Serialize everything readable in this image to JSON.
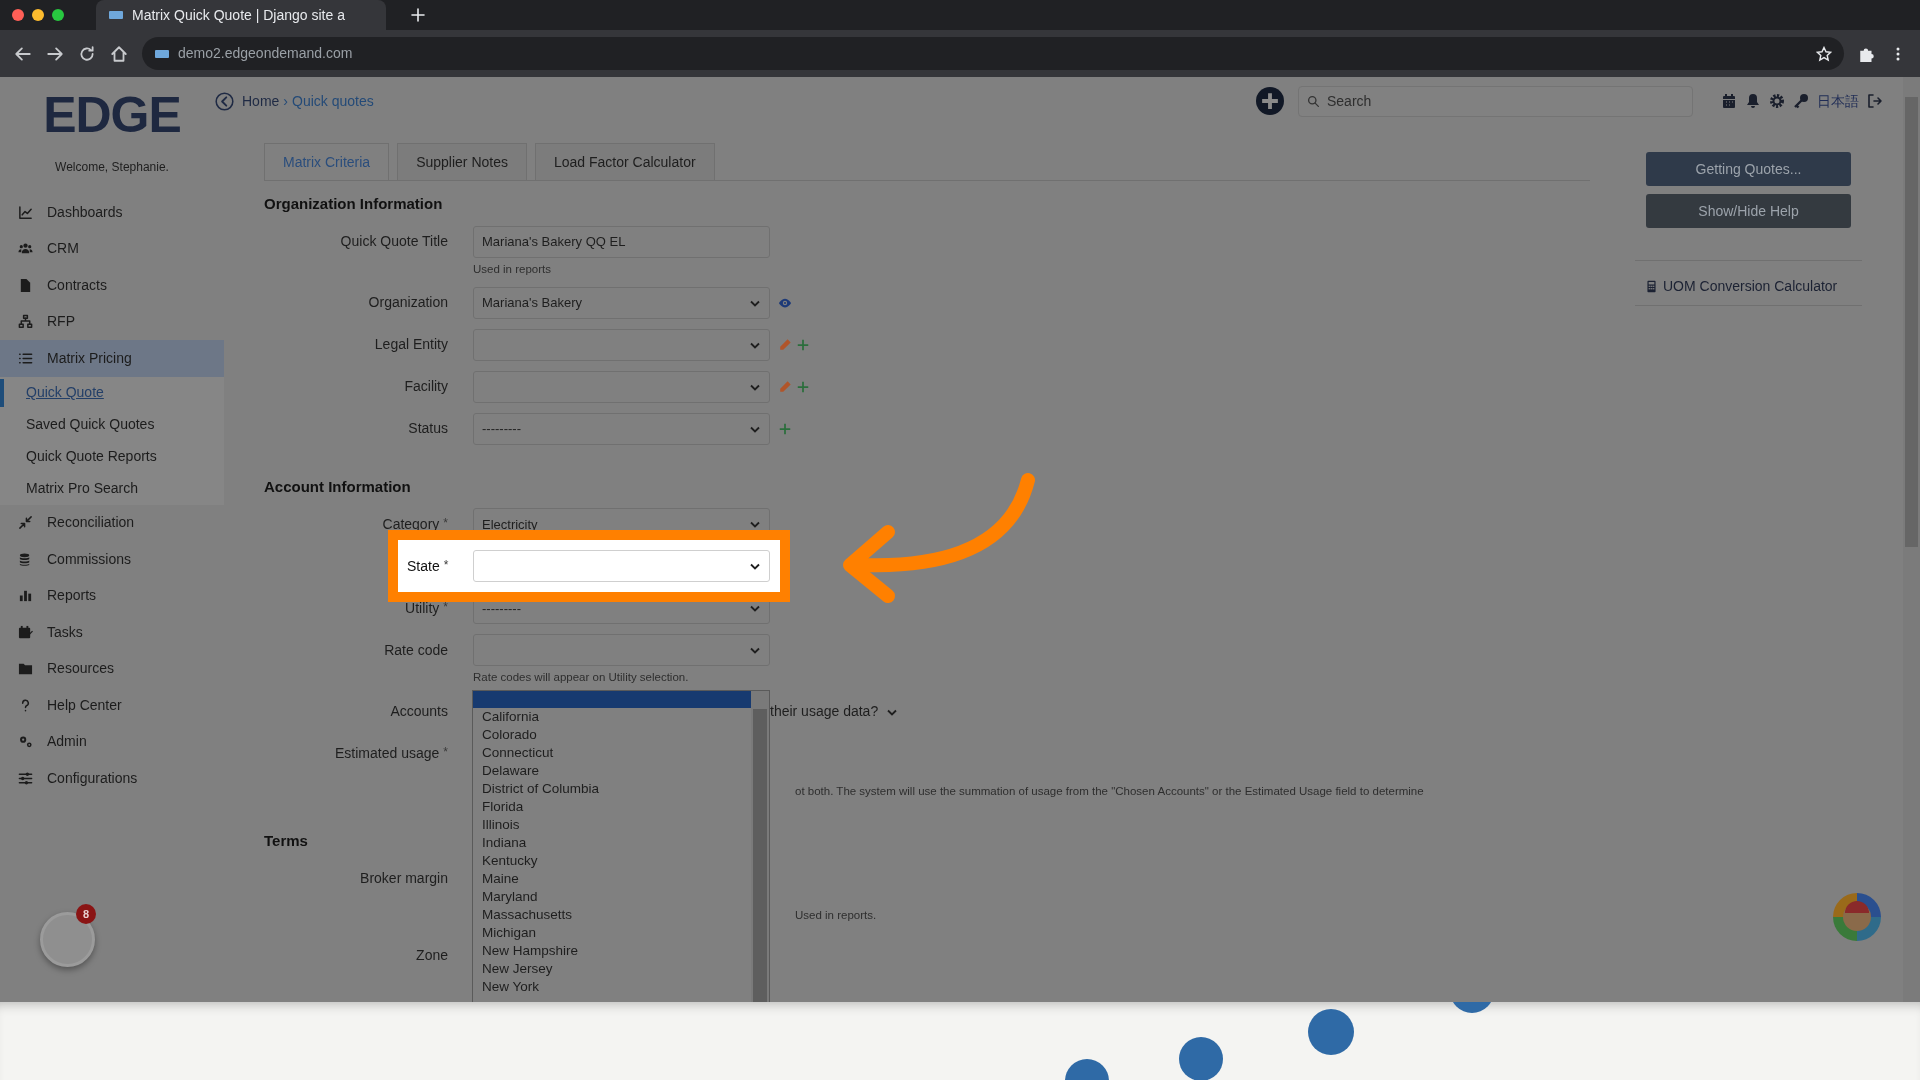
{
  "browser": {
    "tab_title": "Matrix Quick Quote | Django site a",
    "url": "demo2.edgeondemand.com"
  },
  "app": {
    "logo": "EDGE",
    "welcome": "Welcome, Stephanie.",
    "notifications": "8"
  },
  "sidebar": {
    "items": [
      {
        "label": "Dashboards",
        "selected": false
      },
      {
        "label": "CRM",
        "selected": false
      },
      {
        "label": "Contracts",
        "selected": false
      },
      {
        "label": "RFP",
        "selected": false
      },
      {
        "label": "Matrix Pricing",
        "selected": true,
        "expanded": true,
        "children": [
          {
            "label": "Quick Quote",
            "selected": true
          },
          {
            "label": "Saved Quick Quotes",
            "selected": false
          },
          {
            "label": "Quick Quote Reports",
            "selected": false
          },
          {
            "label": "Matrix Pro Search",
            "selected": false
          }
        ]
      },
      {
        "label": "Reconciliation",
        "selected": false
      },
      {
        "label": "Commissions",
        "selected": false
      },
      {
        "label": "Reports",
        "selected": false
      },
      {
        "label": "Tasks",
        "selected": false
      },
      {
        "label": "Resources",
        "selected": false
      },
      {
        "label": "Help Center",
        "selected": false
      },
      {
        "label": "Admin",
        "selected": false
      },
      {
        "label": "Configurations",
        "selected": false
      }
    ]
  },
  "header": {
    "breadcrumb": [
      {
        "label": "Home"
      },
      {
        "label": "Quick quotes"
      }
    ],
    "separator": "›",
    "search": {
      "placeholder": "Search"
    },
    "language": "日本語"
  },
  "tabs": [
    {
      "label": "Matrix Criteria",
      "selected": true
    },
    {
      "label": "Supplier Notes",
      "selected": false
    },
    {
      "label": "Load Factor Calculator",
      "selected": false
    }
  ],
  "sections": [
    {
      "title": "Organization Information",
      "fields": [
        {
          "label": "Quick Quote Title",
          "kind": "text",
          "value": "Mariana's Bakery QQ EL",
          "help": "Used in reports"
        },
        {
          "label": "Organization",
          "kind": "select",
          "value": "Mariana's Bakery",
          "actions": [
            {
              "kind": "view"
            }
          ]
        },
        {
          "label": "Legal Entity",
          "kind": "select",
          "actions": [
            {
              "kind": "edit"
            },
            {
              "kind": "add"
            }
          ]
        },
        {
          "label": "Facility",
          "kind": "select",
          "actions": [
            {
              "kind": "edit"
            },
            {
              "kind": "add"
            }
          ]
        },
        {
          "label": "Status",
          "kind": "select",
          "value": "---------",
          "actions": [
            {
              "kind": "add"
            }
          ]
        }
      ]
    },
    {
      "title": "Account Information",
      "fields": [
        {
          "label": "Category",
          "mark": "*",
          "kind": "select",
          "value": "Electricity"
        },
        {
          "label": "State",
          "mark": "*",
          "kind": "select",
          "highlighted": true,
          "open": true,
          "blank_option_selected": true,
          "options": [
            "California",
            "Colorado",
            "Connecticut",
            "Delaware",
            "District of Columbia",
            "Florida",
            "Illinois",
            "Indiana",
            "Kentucky",
            "Maine",
            "Maryland",
            "Massachusetts",
            "Michigan",
            "New Hampshire",
            "New Jersey",
            "New York"
          ]
        },
        {
          "label": "Utility",
          "mark": "*",
          "kind": "select",
          "value": "---------"
        },
        {
          "label": "Rate code",
          "kind": "select",
          "help": "Rate codes will appear on Utility selection."
        },
        {
          "label": "Accounts",
          "kind": "covered",
          "trailing": "their usage data?",
          "caret": true
        },
        {
          "label": "Estimated usage",
          "mark": "*",
          "kind": "covered",
          "help": "ot both. The system will use the summation of usage from the \"Chosen Accounts\" or the Estimated Usage field to determine"
        }
      ]
    },
    {
      "title": "Terms",
      "fields": [
        {
          "label": "Broker margin",
          "kind": "covered",
          "help": "Used in reports."
        },
        {
          "label": "Zone",
          "kind": "covered"
        }
      ]
    }
  ],
  "right_panel": {
    "buttons": [
      {
        "label": "Getting Quotes...",
        "kind": "primary"
      },
      {
        "label": "Show/Hide Help",
        "kind": "secondary"
      }
    ],
    "links": [
      {
        "label": "UOM Conversion Calculator"
      }
    ]
  }
}
